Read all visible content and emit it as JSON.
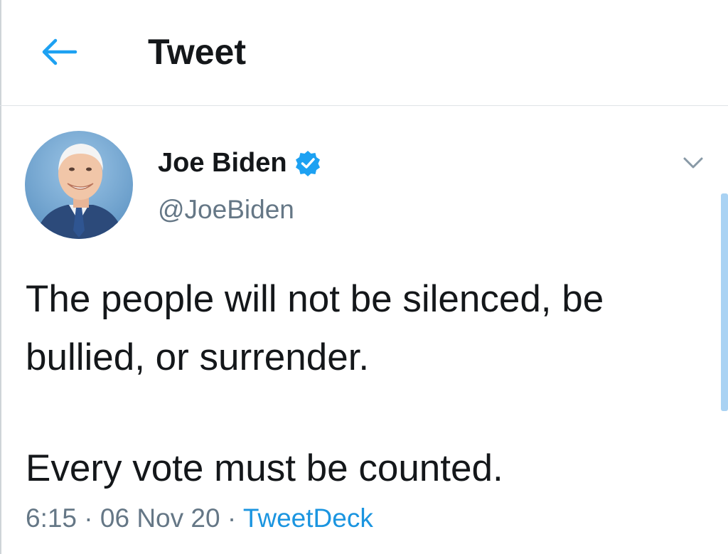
{
  "header": {
    "title": "Tweet",
    "back_icon": "arrow-left-icon"
  },
  "tweet": {
    "author": {
      "name": "Joe Biden",
      "handle": "@JoeBiden",
      "verified": true,
      "avatar_icon": "avatar"
    },
    "menu_icon": "chevron-down-icon",
    "text_lines": [
      "The people will not be silenced, be bullied, or surrender.",
      "Every vote must be counted."
    ],
    "time": "6:15",
    "date": "06 Nov 20",
    "separator": "·",
    "source": "TweetDeck"
  },
  "colors": {
    "accent": "#1da1f2",
    "text_primary": "#14171a",
    "text_secondary": "#657786",
    "source_link": "#1b95e0",
    "scrollbar": "#a9d2f3"
  }
}
